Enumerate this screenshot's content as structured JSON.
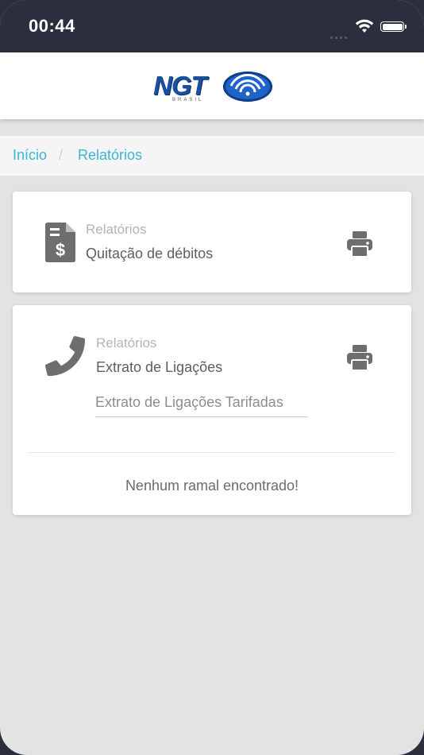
{
  "status_bar": {
    "time": "00:44",
    "icons": [
      "signal-icon",
      "wifi-icon",
      "battery-icon"
    ]
  },
  "header": {
    "logo_text": "NGT",
    "logo_subtext": "BRASIL"
  },
  "breadcrumb": {
    "items": [
      "Início",
      "Relatórios"
    ],
    "separator": "/"
  },
  "cards": [
    {
      "icon": "invoice-dollar-icon",
      "category": "Relatórios",
      "title": "Quitação de débitos",
      "action_icon": "print-icon"
    },
    {
      "icon": "phone-icon",
      "category": "Relatórios",
      "title": "Extrato de Ligações",
      "action_icon": "print-icon",
      "select_placeholder": "Extrato de Ligações Tarifadas",
      "empty_message": "Nenhum ramal encontrado!"
    }
  ],
  "colors": {
    "status_bar": "#2b2f3d",
    "accent_link": "#3ab4d6",
    "background": "#e3e3e3",
    "icon_gray": "#6e6e6e",
    "logo_blue": "#1b4f9f"
  }
}
